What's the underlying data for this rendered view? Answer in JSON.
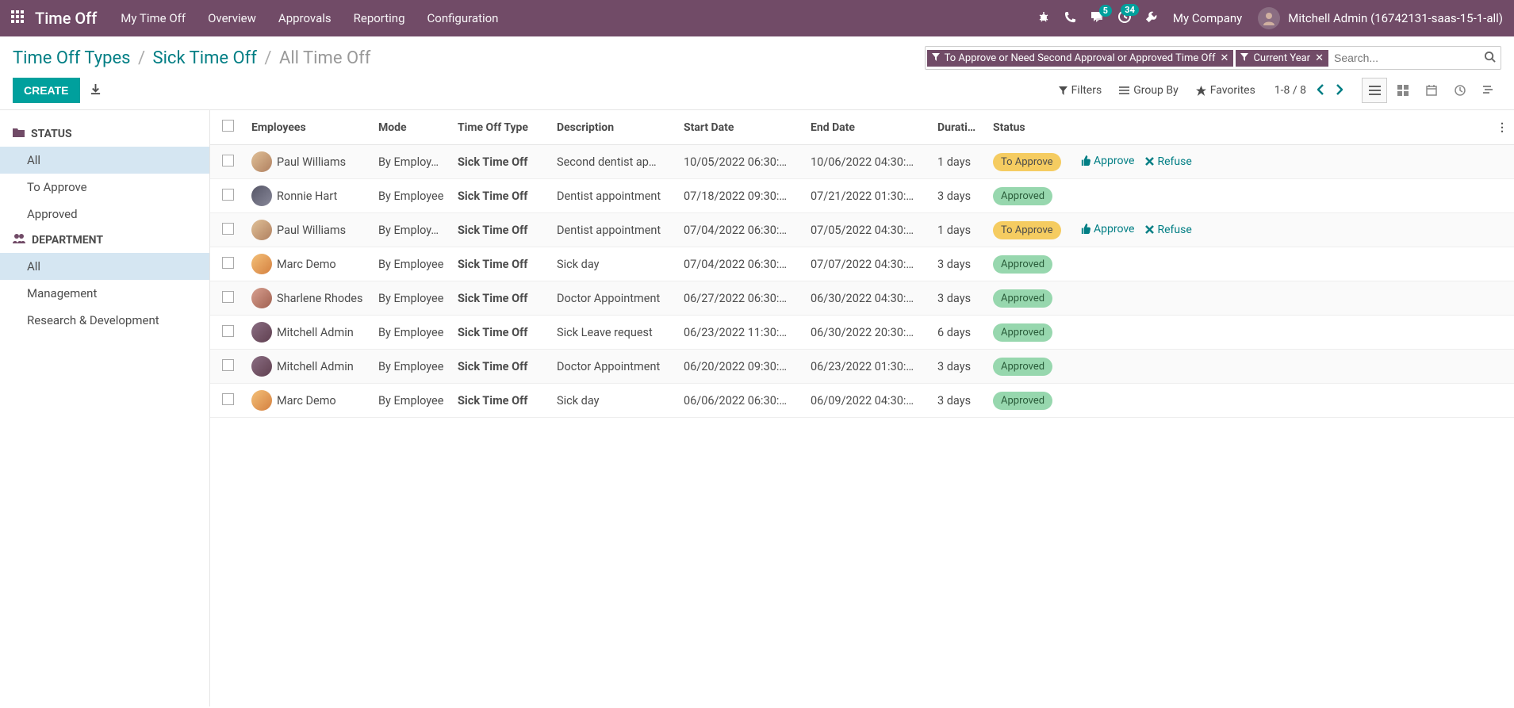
{
  "header": {
    "app_title": "Time Off",
    "nav": [
      "My Time Off",
      "Overview",
      "Approvals",
      "Reporting",
      "Configuration"
    ],
    "messages_badge": "5",
    "activities_badge": "34",
    "company": "My Company",
    "user": "Mitchell Admin (16742131-saas-15-1-all)"
  },
  "breadcrumb": {
    "a": "Time Off Types",
    "b": "Sick Time Off",
    "current": "All Time Off"
  },
  "search": {
    "facet1": "To Approve or Need Second Approval or Approved Time Off",
    "facet2": "Current Year",
    "placeholder": "Search..."
  },
  "buttons": {
    "create": "CREATE",
    "filters": "Filters",
    "group_by": "Group By",
    "favorites": "Favorites"
  },
  "pager": {
    "text": "1-8 / 8"
  },
  "sidebar": {
    "status_header": "STATUS",
    "status_items": [
      "All",
      "To Approve",
      "Approved"
    ],
    "dept_header": "DEPARTMENT",
    "dept_items": [
      "All",
      "Management",
      "Research & Development"
    ]
  },
  "table": {
    "headers": [
      "Employees",
      "Mode",
      "Time Off Type",
      "Description",
      "Start Date",
      "End Date",
      "Durati…",
      "Status"
    ],
    "rows": [
      {
        "employee": "Paul Williams",
        "avatar": "a1",
        "mode": "By Employ…",
        "type": "Sick Time Off",
        "desc": "Second dentist ap…",
        "start": "10/05/2022 06:30:…",
        "end": "10/06/2022 04:30:…",
        "dur": "1 days",
        "status": "To Approve",
        "status_class": "approve",
        "actions": true
      },
      {
        "employee": "Ronnie Hart",
        "avatar": "a2",
        "mode": "By Employee",
        "type": "Sick Time Off",
        "desc": "Dentist appointment",
        "start": "07/18/2022 09:30:…",
        "end": "07/21/2022 01:30:…",
        "dur": "3 days",
        "status": "Approved",
        "status_class": "approved",
        "actions": false
      },
      {
        "employee": "Paul Williams",
        "avatar": "a1",
        "mode": "By Employ…",
        "type": "Sick Time Off",
        "desc": "Dentist appointment",
        "start": "07/04/2022 06:30:…",
        "end": "07/05/2022 04:30:…",
        "dur": "1 days",
        "status": "To Approve",
        "status_class": "approve",
        "actions": true
      },
      {
        "employee": "Marc Demo",
        "avatar": "a3",
        "mode": "By Employee",
        "type": "Sick Time Off",
        "desc": "Sick day",
        "start": "07/04/2022 06:30:…",
        "end": "07/07/2022 04:30:…",
        "dur": "3 days",
        "status": "Approved",
        "status_class": "approved",
        "actions": false
      },
      {
        "employee": "Sharlene Rhodes",
        "avatar": "a4",
        "mode": "By Employee",
        "type": "Sick Time Off",
        "desc": "Doctor Appointment",
        "start": "06/27/2022 06:30:…",
        "end": "06/30/2022 04:30:…",
        "dur": "3 days",
        "status": "Approved",
        "status_class": "approved",
        "actions": false
      },
      {
        "employee": "Mitchell Admin",
        "avatar": "a5",
        "mode": "By Employee",
        "type": "Sick Time Off",
        "desc": "Sick Leave request",
        "start": "06/23/2022 11:30:…",
        "end": "06/30/2022 20:30:…",
        "dur": "6 days",
        "status": "Approved",
        "status_class": "approved",
        "actions": false
      },
      {
        "employee": "Mitchell Admin",
        "avatar": "a5",
        "mode": "By Employee",
        "type": "Sick Time Off",
        "desc": "Doctor Appointment",
        "start": "06/20/2022 09:30:…",
        "end": "06/23/2022 01:30:…",
        "dur": "3 days",
        "status": "Approved",
        "status_class": "approved",
        "actions": false
      },
      {
        "employee": "Marc Demo",
        "avatar": "a3",
        "mode": "By Employee",
        "type": "Sick Time Off",
        "desc": "Sick day",
        "start": "06/06/2022 06:30:…",
        "end": "06/09/2022 04:30:…",
        "dur": "3 days",
        "status": "Approved",
        "status_class": "approved",
        "actions": false
      }
    ],
    "approve_label": "Approve",
    "refuse_label": "Refuse"
  }
}
